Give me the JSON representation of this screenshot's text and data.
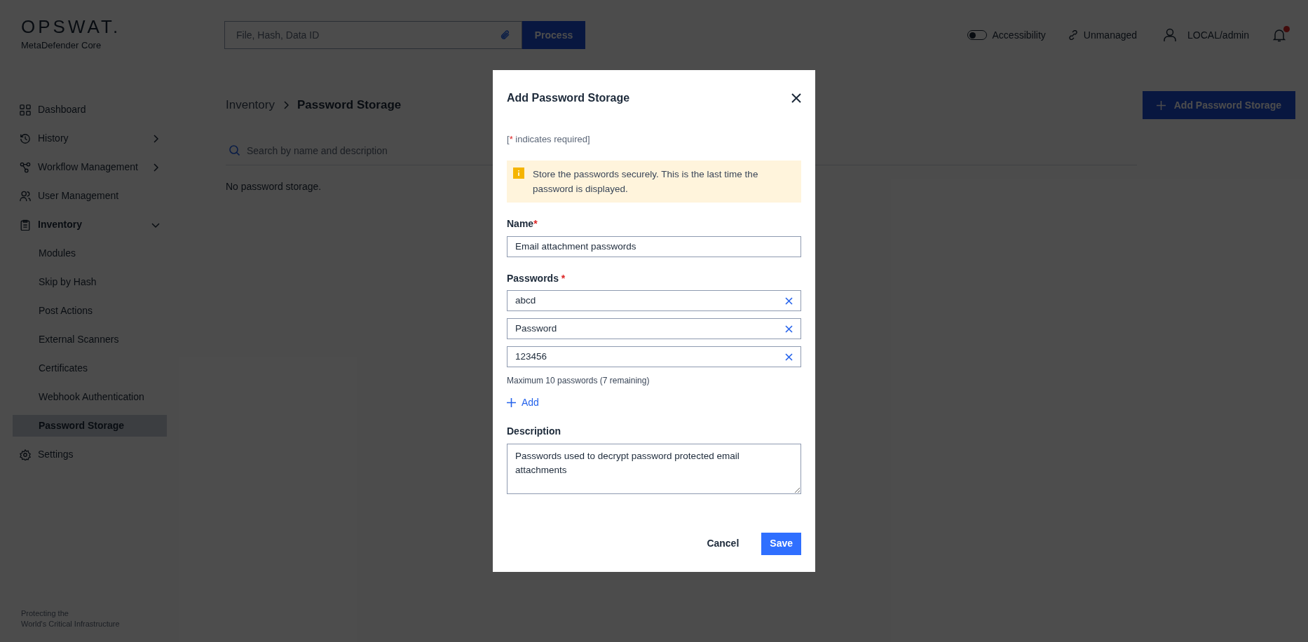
{
  "header": {
    "logo": "OPSWAT.",
    "product": "MetaDefender Core",
    "search": {
      "placeholder": "File, Hash, Data ID"
    },
    "process_button": "Process",
    "accessibility": {
      "label": "Accessibility",
      "on": false
    },
    "management": "Unmanaged",
    "user": "LOCAL/admin",
    "notifications": {
      "unread": true
    }
  },
  "sidebar": {
    "items": [
      {
        "label": "Dashboard",
        "selected": false
      },
      {
        "label": "History",
        "selected": false,
        "expanded": false
      },
      {
        "label": "Workflow Management",
        "selected": false,
        "expanded": false
      },
      {
        "label": "User Management",
        "selected": false
      },
      {
        "label": "Inventory",
        "selected": false,
        "expanded": true,
        "children": [
          {
            "label": "Modules",
            "selected": false
          },
          {
            "label": "Skip by Hash",
            "selected": false
          },
          {
            "label": "Post Actions",
            "selected": false
          },
          {
            "label": "External Scanners",
            "selected": false
          },
          {
            "label": "Certificates",
            "selected": false
          },
          {
            "label": "Webhook Authentication",
            "selected": false
          },
          {
            "label": "Password Storage",
            "selected": true
          }
        ]
      },
      {
        "label": "Settings",
        "selected": false
      }
    ],
    "footer": [
      "Protecting the",
      "World's Critical Infrastructure"
    ]
  },
  "content": {
    "breadcrumb": [
      "Inventory",
      "Password Storage"
    ],
    "add_button": "Add Password Storage",
    "search": {
      "placeholder": "Search by name and description"
    },
    "empty_message": "No password storage."
  },
  "dialog": {
    "title": "Add Password Storage",
    "required_note": {
      "before": "[",
      "mark": "*",
      "after": " indicates required]"
    },
    "alert": "Store the passwords securely. This is the last time the password is displayed.",
    "name": {
      "label": "Name",
      "mark": "*",
      "value": "Email attachment passwords"
    },
    "passwords": {
      "label": "Passwords ",
      "mark": "*",
      "values": [
        "abcd",
        "Password",
        "123456"
      ],
      "hint": "Maximum 10 passwords (7 remaining)",
      "add": "Add"
    },
    "description": {
      "label": "Description",
      "value": "Passwords used to decrypt password protected email attachments"
    },
    "buttons": {
      "cancel": "Cancel",
      "save": "Save"
    }
  }
}
